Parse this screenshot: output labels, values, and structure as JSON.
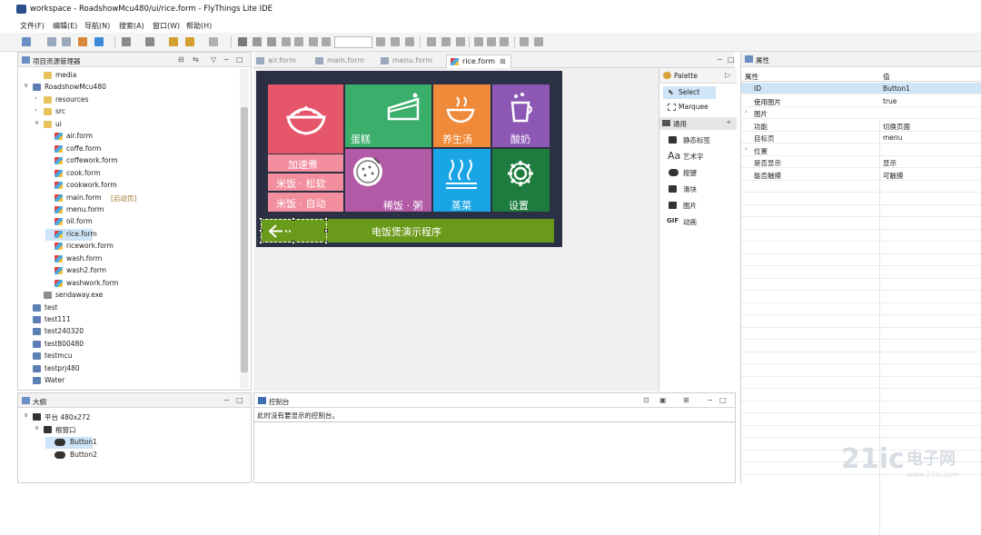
{
  "window": {
    "title": "workspace - RoadshowMcu480/ui/rice.form - FlyThings Lite IDE"
  },
  "menubar": [
    "文件(F)",
    "编辑(E)",
    "导航(N)",
    "搜索(A)",
    "窗口(W)",
    "帮助(H)"
  ],
  "project_explorer": {
    "title": "项目资源管理器",
    "items": [
      {
        "label": "media",
        "type": "folder",
        "depth": 1,
        "caret": ""
      },
      {
        "label": "RoadshowMcu480",
        "type": "proj",
        "depth": 0,
        "caret": "v"
      },
      {
        "label": "resources",
        "type": "folder",
        "depth": 1,
        "caret": ">"
      },
      {
        "label": "src",
        "type": "folder",
        "depth": 1,
        "caret": ">"
      },
      {
        "label": "ui",
        "type": "folder",
        "depth": 1,
        "caret": "v"
      },
      {
        "label": "air.form",
        "type": "form",
        "depth": 2,
        "caret": ""
      },
      {
        "label": "coffe.form",
        "type": "form",
        "depth": 2,
        "caret": ""
      },
      {
        "label": "coffework.form",
        "type": "form",
        "depth": 2,
        "caret": ""
      },
      {
        "label": "cook.form",
        "type": "form",
        "depth": 2,
        "caret": ""
      },
      {
        "label": "cookwork.form",
        "type": "form",
        "depth": 2,
        "caret": ""
      },
      {
        "label": "main.form",
        "type": "form",
        "depth": 2,
        "caret": "",
        "hint": "[启动页]"
      },
      {
        "label": "menu.form",
        "type": "form",
        "depth": 2,
        "caret": ""
      },
      {
        "label": "oil.form",
        "type": "form",
        "depth": 2,
        "caret": ""
      },
      {
        "label": "rice.form",
        "type": "form",
        "depth": 2,
        "caret": "",
        "selected": true
      },
      {
        "label": "ricework.form",
        "type": "form",
        "depth": 2,
        "caret": ""
      },
      {
        "label": "wash.form",
        "type": "form",
        "depth": 2,
        "caret": ""
      },
      {
        "label": "wash2.form",
        "type": "form",
        "depth": 2,
        "caret": ""
      },
      {
        "label": "washwork.form",
        "type": "form",
        "depth": 2,
        "caret": ""
      },
      {
        "label": "sendaway.exe",
        "type": "exe",
        "depth": 1,
        "caret": ""
      },
      {
        "label": "test",
        "type": "proj",
        "depth": 0,
        "caret": ""
      },
      {
        "label": "test111",
        "type": "proj",
        "depth": 0,
        "caret": ""
      },
      {
        "label": "test240320",
        "type": "proj",
        "depth": 0,
        "caret": ""
      },
      {
        "label": "test800480",
        "type": "proj",
        "depth": 0,
        "caret": ""
      },
      {
        "label": "testmcu",
        "type": "proj",
        "depth": 0,
        "caret": ""
      },
      {
        "label": "testprj480",
        "type": "proj",
        "depth": 0,
        "caret": ""
      },
      {
        "label": "Water",
        "type": "proj",
        "depth": 0,
        "caret": ""
      }
    ]
  },
  "outline": {
    "title": "大纲",
    "items": [
      {
        "label": "平台 480x272",
        "depth": 0,
        "caret": "v"
      },
      {
        "label": "根窗口",
        "depth": 1,
        "caret": "v"
      },
      {
        "label": "Button1",
        "depth": 2,
        "caret": "",
        "selected": true
      },
      {
        "label": "Button2",
        "depth": 2,
        "caret": ""
      }
    ]
  },
  "editor": {
    "tabs": [
      {
        "label": "air.form",
        "active": false
      },
      {
        "label": "main.form",
        "active": false
      },
      {
        "label": "menu.form",
        "active": false
      },
      {
        "label": "rice.form",
        "active": true,
        "close": "⊠"
      }
    ],
    "tiles": {
      "rice": {
        "label": "",
        "color": "#e6566b"
      },
      "cake": {
        "label": "蛋糕",
        "color": "#3aae6a"
      },
      "soup": {
        "label": "养生汤",
        "color": "#ef8a3a"
      },
      "yogurt": {
        "label": "酸奶",
        "color": "#8c58b4"
      },
      "quick": {
        "label": "加速煮",
        "color": "#f28e9e"
      },
      "soft": {
        "label": "米饭 · 松软",
        "color": "#f28e9e"
      },
      "auto": {
        "label": "米饭 · 自动",
        "color": "#f28e9e"
      },
      "porridge": {
        "label": "稀饭 · 粥",
        "color": "#b35aa6"
      },
      "steam": {
        "label": "蒸菜",
        "color": "#1aa6e6"
      },
      "settings": {
        "label": "设置",
        "color": "#1e7d3e"
      }
    },
    "bottom_bar": {
      "label": "电饭煲演示程序",
      "color": "#6a9a1a"
    }
  },
  "palette": {
    "title": "Palette",
    "select": "Select",
    "marquee": "Marquee",
    "section": "通用",
    "items": [
      "静态标签",
      "艺术字",
      "按键",
      "滑块",
      "图片",
      "动画"
    ]
  },
  "console": {
    "title": "控制台",
    "message": "此时没有要显示的控制台。"
  },
  "properties": {
    "title": "属性",
    "col_name": "属性",
    "col_value": "值",
    "rows": [
      {
        "k": "ID",
        "v": "Button1",
        "selected": true,
        "caret": ""
      },
      {
        "k": "使用图片",
        "v": "true",
        "caret": ""
      },
      {
        "k": "图片",
        "v": "",
        "caret": ">"
      },
      {
        "k": "功能",
        "v": "切换页面",
        "caret": ""
      },
      {
        "k": "目标页",
        "v": "menu",
        "caret": ""
      },
      {
        "k": "位置",
        "v": "",
        "caret": ">"
      },
      {
        "k": "是否显示",
        "v": "显示",
        "caret": ""
      },
      {
        "k": "能否触摸",
        "v": "可触摸",
        "caret": ""
      }
    ]
  },
  "watermark": {
    "text": "21ic电子网",
    "sub": "www.21ic.com"
  }
}
